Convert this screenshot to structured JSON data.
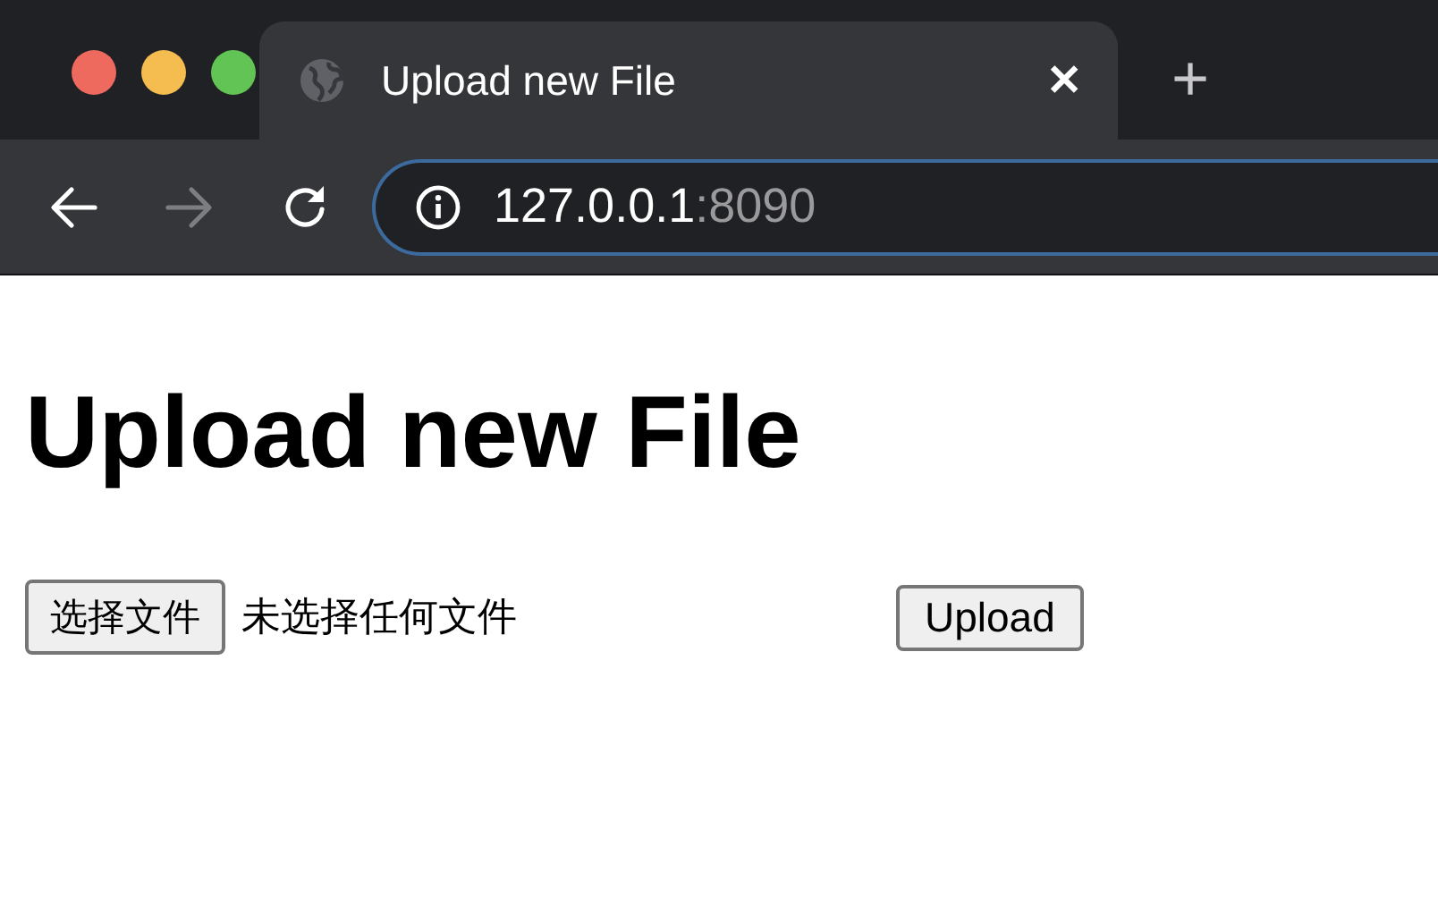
{
  "window_controls": [
    {
      "color": "#ee6a5f"
    },
    {
      "color": "#f5bd4f"
    },
    {
      "color": "#61c454"
    }
  ],
  "tab": {
    "title": "Upload new File",
    "close": "✕",
    "new_tab": "+"
  },
  "nav_buttons": [
    {
      "kind": "back",
      "disabled": false
    },
    {
      "kind": "forward",
      "disabled": true
    },
    {
      "kind": "reload",
      "disabled": false
    }
  ],
  "address": {
    "host": "127.0.0.1",
    "port": ":8090"
  },
  "page": {
    "heading": "Upload new File",
    "choose_button": "选择文件",
    "file_status": "未选择任何文件",
    "upload_button": "Upload"
  }
}
